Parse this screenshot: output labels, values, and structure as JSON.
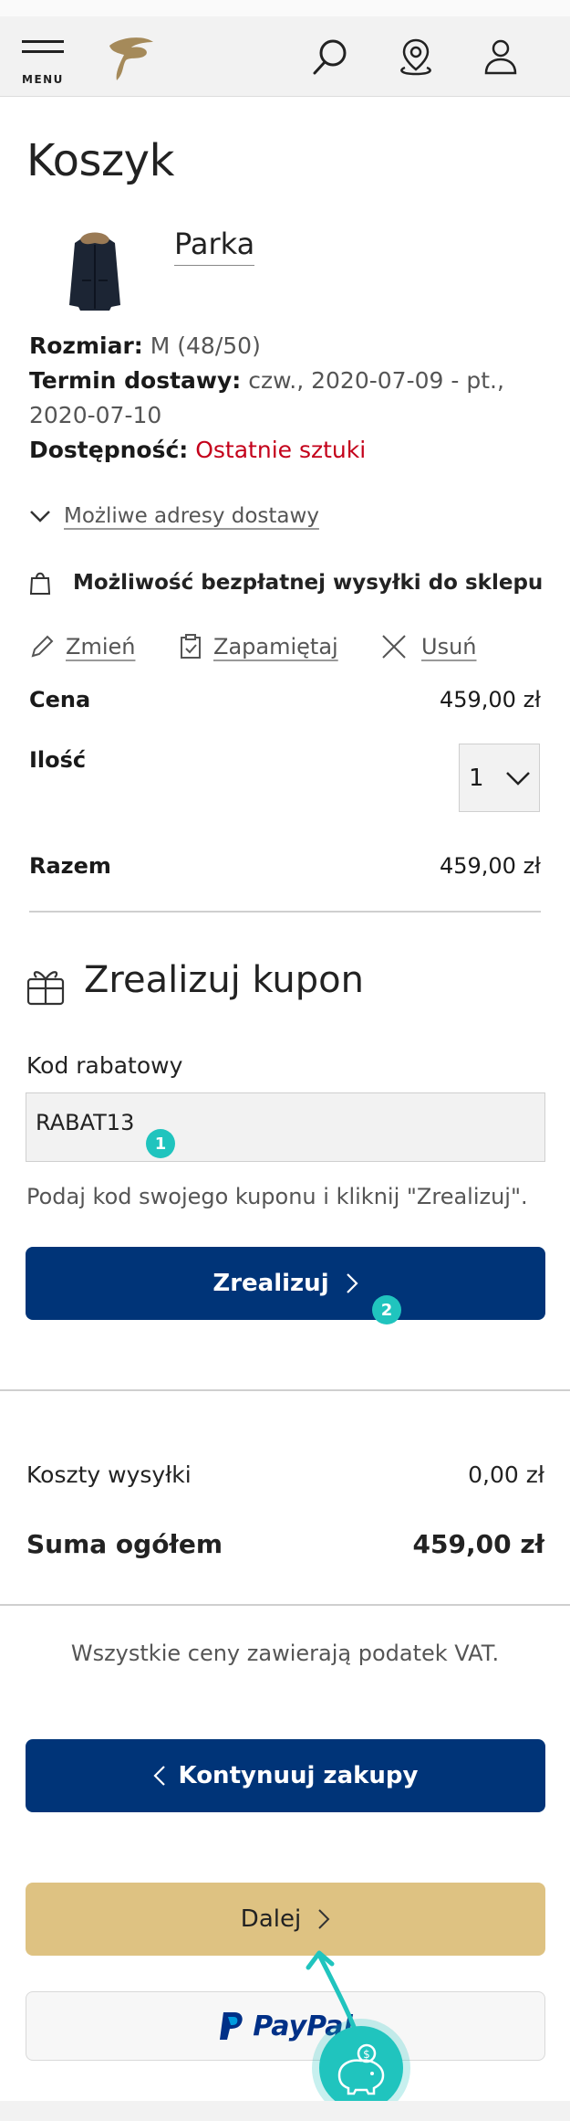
{
  "header": {
    "menu_label": "MENU",
    "logo": "tchibo-logo",
    "icons": [
      "search-icon",
      "store-locator-icon",
      "account-icon"
    ]
  },
  "page_title": "Koszyk",
  "product": {
    "name": "Parka",
    "size_label": "Rozmiar:",
    "size_value": "M (48/50)",
    "delivery_label": "Termin dostawy:",
    "delivery_value_line1": "czw., 2020-07-09 - pt.,",
    "delivery_value_line2": "2020-07-10",
    "availability_label": "Dostępność:",
    "availability_value": "Ostatnie sztuki",
    "addresses_link": "Możliwe adresy dostawy",
    "free_shipping": "Możliwość bezpłatnej wysyłki do sklepu",
    "actions": {
      "edit": "Zmień",
      "save": "Zapamiętaj",
      "remove": "Usuń"
    },
    "price_label": "Cena",
    "price_value": "459,00 zł",
    "quantity_label": "Ilość",
    "quantity_value": "1",
    "total_label": "Razem",
    "total_value": "459,00 zł"
  },
  "coupon": {
    "title": "Zrealizuj kupon",
    "field_label": "Kod rabatowy",
    "field_value": "RABAT13",
    "hint": "Podaj kod swojego kuponu i kliknij \"Zrealizuj\".",
    "button": "Zrealizuj"
  },
  "summary": {
    "shipping_label": "Koszty wysyłki",
    "shipping_value": "0,00 zł",
    "grand_total_label": "Suma ogółem",
    "grand_total_value": "459,00 zł",
    "vat_note": "Wszystkie ceny zawierają podatek VAT."
  },
  "buttons": {
    "continue": "Kontynuuj zakupy",
    "next": "Dalej",
    "paypal": "PayPal"
  },
  "markers": [
    "1",
    "2"
  ],
  "colors": {
    "primary_blue": "#003478",
    "gold": "#dec282",
    "accent_teal": "#20c4be",
    "alert_red": "#c4001a"
  }
}
